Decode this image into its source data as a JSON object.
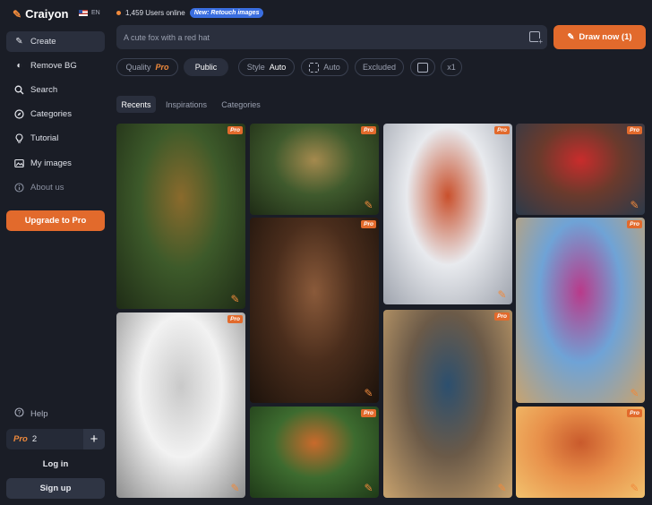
{
  "brand": {
    "name": "Craiyon",
    "lang": "EN"
  },
  "sidebar": {
    "items": [
      {
        "label": "Create",
        "icon": "pencil-icon"
      },
      {
        "label": "Remove BG",
        "icon": "half-circle-icon"
      },
      {
        "label": "Search",
        "icon": "search-icon"
      },
      {
        "label": "Categories",
        "icon": "compass-icon"
      },
      {
        "label": "Tutorial",
        "icon": "lightbulb-icon"
      },
      {
        "label": "My images",
        "icon": "image-icon"
      },
      {
        "label": "About us",
        "icon": "info-icon"
      }
    ],
    "upgrade_label": "Upgrade to Pro",
    "help_label": "Help",
    "pro_label": "Pro",
    "pro_count": "2",
    "login_label": "Log in",
    "signup_label": "Sign up"
  },
  "topbar": {
    "online_text": "1,459 Users online",
    "new_badge": "New: Retouch images"
  },
  "prompt": {
    "placeholder": "A cute fox with a red hat",
    "draw_label": "Draw now (1)"
  },
  "options": {
    "quality_label": "Quality",
    "quality_value": "Pro",
    "visibility_value": "Public",
    "style_label": "Style",
    "style_value": "Auto",
    "ratio_value": "Auto",
    "excluded_label": "Excluded",
    "count_label": "x1"
  },
  "tabs": [
    "Recents",
    "Inspirations",
    "Categories"
  ],
  "gallery": {
    "pro_badge": "Pro",
    "tiles": [
      {
        "name": "tile-warrior-jungle",
        "colors": [
          "#3d5a2a",
          "#8a6a2c",
          "#1f2c16"
        ]
      },
      {
        "name": "tile-coloring-sleigh",
        "colors": [
          "#f2f2f2",
          "#c9c9c9",
          "#8d8d8d"
        ]
      },
      {
        "name": "tile-wizard-face",
        "colors": [
          "#3f5a2d",
          "#a58a4e",
          "#1e2b15"
        ]
      },
      {
        "name": "tile-bearded-man",
        "colors": [
          "#4a2d1c",
          "#8a5a3a",
          "#1c120b"
        ]
      },
      {
        "name": "tile-fox-red-hat",
        "colors": [
          "#3d6b2f",
          "#c96a2c",
          "#1f3a18"
        ]
      },
      {
        "name": "tile-sausage-napkin",
        "colors": [
          "#e8eaee",
          "#c9502c",
          "#9ea3ad"
        ]
      },
      {
        "name": "tile-cafe-street",
        "colors": [
          "#6b5a48",
          "#2c4f6e",
          "#c9a36e"
        ]
      },
      {
        "name": "tile-santa-desk",
        "colors": [
          "#6b3a2c",
          "#c92c2c",
          "#2c3a4a"
        ]
      },
      {
        "name": "tile-dancer-street",
        "colors": [
          "#6fa3d6",
          "#b93a8a",
          "#c9a36e"
        ]
      },
      {
        "name": "tile-dragon-sombrero",
        "colors": [
          "#e8904a",
          "#c95a2c",
          "#f2c26e"
        ]
      }
    ]
  }
}
